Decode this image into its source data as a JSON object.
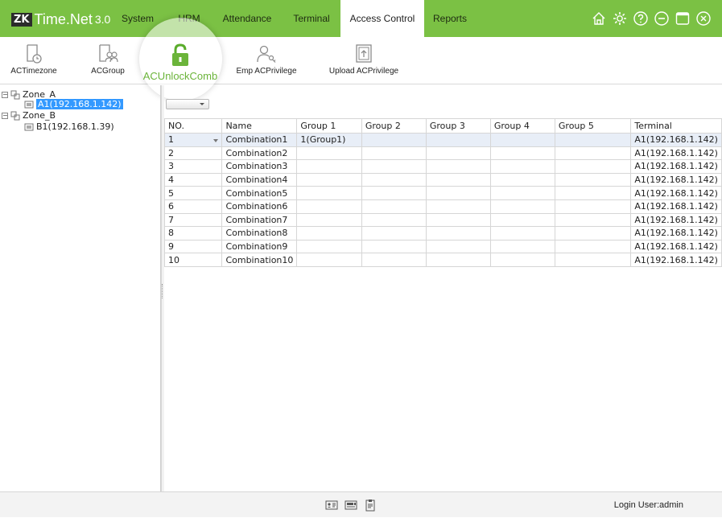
{
  "app": {
    "logo_mark": "ZK",
    "logo_name": "Time.Net",
    "logo_version": "3.0"
  },
  "nav": {
    "items": [
      {
        "label": "System"
      },
      {
        "label": "HRM"
      },
      {
        "label": "Attendance"
      },
      {
        "label": "Terminal"
      },
      {
        "label": "Access Control",
        "active": true
      },
      {
        "label": "Reports"
      }
    ],
    "window_icons": [
      "home-icon",
      "settings-gear-icon",
      "help-icon",
      "minimize-icon",
      "maximize-icon",
      "close-icon"
    ]
  },
  "ribbon": {
    "buttons": [
      {
        "label": "ACTimezone",
        "icon": "document-clock-icon"
      },
      {
        "label": "ACGroup",
        "icon": "document-group-icon"
      },
      {
        "label": "ACUnlockComb",
        "icon": "unlock-padlock-icon",
        "selected": true
      },
      {
        "label": "Emp ACPrivilege",
        "icon": "user-key-icon"
      },
      {
        "label": "Upload ACPrivilege",
        "icon": "upload-document-icon"
      }
    ]
  },
  "tree": {
    "zones": [
      {
        "label": "Zone_A",
        "devices": [
          {
            "label": "A1(192.168.1.142)",
            "selected": true
          }
        ]
      },
      {
        "label": "Zone_B",
        "devices": [
          {
            "label": "B1(192.168.1.39)",
            "selected": false
          }
        ]
      }
    ]
  },
  "filter": {
    "value": ""
  },
  "table": {
    "headers": [
      "NO.",
      "Name",
      "Group 1",
      "Group 2",
      "Group 3",
      "Group 4",
      "Group 5",
      "Terminal"
    ],
    "rows": [
      [
        "1",
        "Combination1",
        "1(Group1)",
        "",
        "",
        "",
        "",
        "A1(192.168.1.142)"
      ],
      [
        "2",
        "Combination2",
        "",
        "",
        "",
        "",
        "",
        "A1(192.168.1.142)"
      ],
      [
        "3",
        "Combination3",
        "",
        "",
        "",
        "",
        "",
        "A1(192.168.1.142)"
      ],
      [
        "4",
        "Combination4",
        "",
        "",
        "",
        "",
        "",
        "A1(192.168.1.142)"
      ],
      [
        "5",
        "Combination5",
        "",
        "",
        "",
        "",
        "",
        "A1(192.168.1.142)"
      ],
      [
        "6",
        "Combination6",
        "",
        "",
        "",
        "",
        "",
        "A1(192.168.1.142)"
      ],
      [
        "7",
        "Combination7",
        "",
        "",
        "",
        "",
        "",
        "A1(192.168.1.142)"
      ],
      [
        "8",
        "Combination8",
        "",
        "",
        "",
        "",
        "",
        "A1(192.168.1.142)"
      ],
      [
        "9",
        "Combination9",
        "",
        "",
        "",
        "",
        "",
        "A1(192.168.1.142)"
      ],
      [
        "10",
        "Combination10",
        "",
        "",
        "",
        "",
        "",
        "A1(192.168.1.142)"
      ]
    ]
  },
  "footer": {
    "icons": [
      "id-card-icon",
      "device-list-icon",
      "clipboard-icon"
    ],
    "login_text": "Login User:admin"
  },
  "colors": {
    "accent": "#7bc144",
    "selection": "#3399ff",
    "selected_row": "#e8eef7"
  }
}
